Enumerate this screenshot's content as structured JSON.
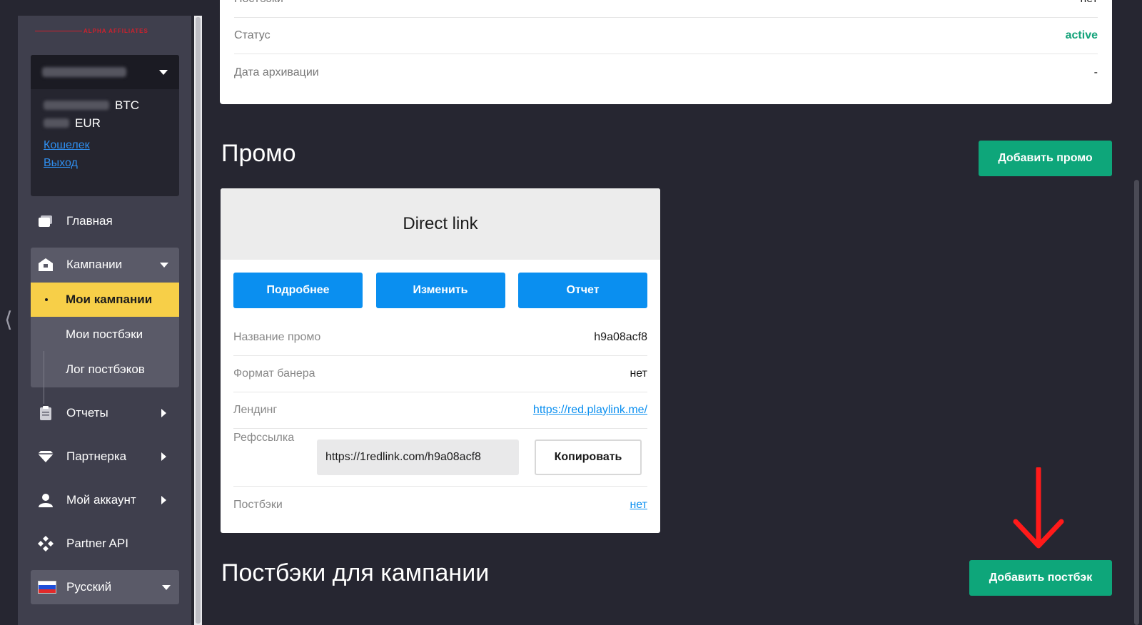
{
  "brand": {
    "logo_text": "ALPHA AFFILIATES"
  },
  "user": {
    "balances": [
      {
        "currency": "BTC"
      },
      {
        "currency": "EUR"
      }
    ],
    "links": {
      "wallet": "Кошелек",
      "logout": "Выход"
    }
  },
  "nav": {
    "home": "Главная",
    "campaigns": "Кампании",
    "campaigns_sub": {
      "my_campaigns": "Мои кампании",
      "my_postbacks": "Мои постбэки",
      "postback_log": "Лог постбэков"
    },
    "reports": "Отчеты",
    "partner": "Партнерка",
    "account": "Мой аккаунт",
    "api": "Partner API",
    "language": "Русский"
  },
  "campaign_info": {
    "rows": [
      {
        "label": "Постбэки",
        "value": "нет"
      },
      {
        "label": "Статус",
        "value": "active"
      },
      {
        "label": "Дата архивации",
        "value": "-"
      }
    ]
  },
  "promo_section": {
    "title": "Промо",
    "add_button": "Добавить промо",
    "card": {
      "title": "Direct link",
      "buttons": {
        "details": "Подробнее",
        "edit": "Изменить",
        "report": "Отчет"
      },
      "rows": {
        "name_label": "Название промо",
        "name_value": "h9a08acf8",
        "format_label": "Формат банера",
        "format_value": "нет",
        "landing_label": "Лендинг",
        "landing_value": "https://red.playlink.me/",
        "ref_label": "Рефссылка",
        "ref_value": "https://1redlink.com/h9a08acf8",
        "copy_button": "Копировать",
        "postbacks_label": "Постбэки",
        "postbacks_value": "нет"
      }
    }
  },
  "postbacks_section": {
    "title": "Постбэки для кампании",
    "add_button": "Добавить постбэк"
  },
  "colors": {
    "accent_green": "#0ea67a",
    "accent_blue": "#0a8ff0",
    "active_yellow": "#f7cf48",
    "annotation_red": "#ff1a1a"
  }
}
